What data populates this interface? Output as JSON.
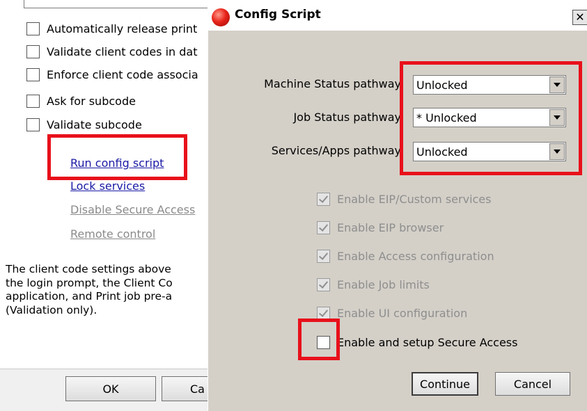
{
  "background_window": {
    "checkboxes": [
      {
        "label": "Automatically release print",
        "checked": false
      },
      {
        "label": "Validate client codes in dat",
        "checked": false
      },
      {
        "label": "Enforce client code associa",
        "checked": false
      },
      {
        "label": "Ask for subcode",
        "checked": false
      },
      {
        "label": "Validate subcode",
        "checked": false
      }
    ],
    "links": {
      "run_config_script": "Run config script",
      "lock_services": "Lock services",
      "disable_secure_access": "Disable Secure Access",
      "remote_control": "Remote control"
    },
    "info_lines": [
      "The client code settings above",
      "the login prompt, the Client Co",
      "application, and Print job pre-a",
      "(Validation only)."
    ],
    "ok_label": "OK",
    "cancel_label_partial": "Ca"
  },
  "dialog": {
    "title": "Config Script",
    "close_glyph": "✕",
    "fields": {
      "machine_status_label": "Machine Status pathway",
      "machine_status_value": "Unlocked",
      "job_status_label": "Job Status pathway",
      "job_status_value": "* Unlocked",
      "services_apps_label": "Services/Apps pathway",
      "services_apps_value": "Unlocked"
    },
    "options": [
      {
        "label": "Enable EIP/Custom services",
        "checked": true,
        "enabled": false
      },
      {
        "label": "Enable EIP browser",
        "checked": true,
        "enabled": false
      },
      {
        "label": "Enable Access configuration",
        "checked": true,
        "enabled": false
      },
      {
        "label": "Enable Job limits",
        "checked": true,
        "enabled": false
      },
      {
        "label": "Enable UI configuration",
        "checked": true,
        "enabled": false
      },
      {
        "label": "Enable and setup Secure Access",
        "checked": false,
        "enabled": true
      }
    ],
    "continue_label": "Continue",
    "cancel_label": "Cancel"
  },
  "colors": {
    "highlight": "#e8101a",
    "dialog_bg": "#d4d0c8",
    "link": "#1a1aa6",
    "disabled_text": "#8e8e8e"
  }
}
